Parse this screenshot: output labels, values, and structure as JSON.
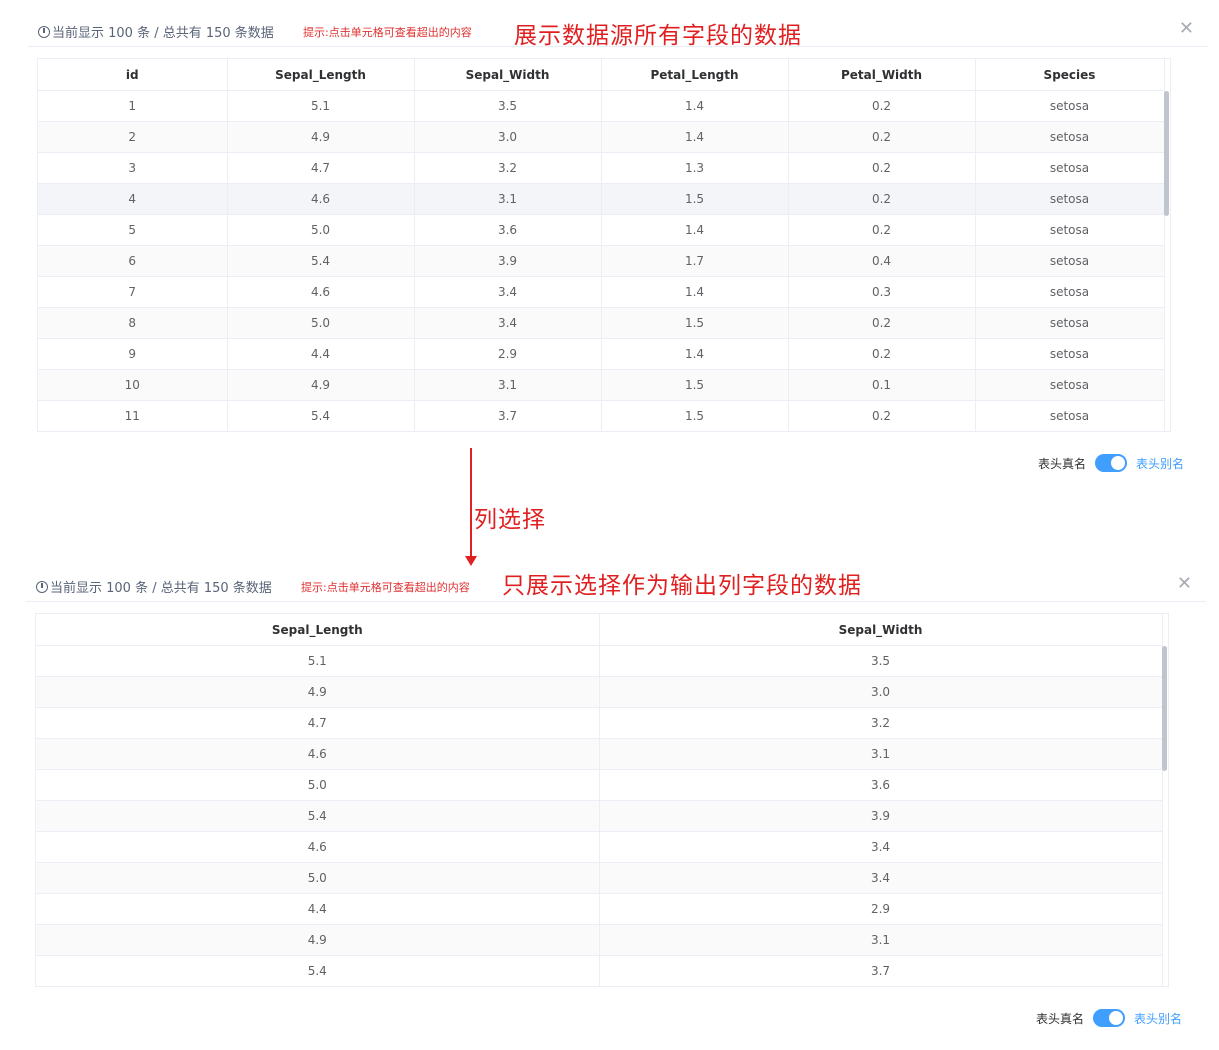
{
  "top": {
    "info": "当前显示 100 条 / 总共有 150 条数据",
    "hint": "提示:点击单元格可查看超出的内容",
    "annotation": "展示数据源所有字段的数据",
    "columns": [
      "id",
      "Sepal_Length",
      "Sepal_Width",
      "Petal_Length",
      "Petal_Width",
      "Species"
    ],
    "rows": [
      [
        "1",
        "5.1",
        "3.5",
        "1.4",
        "0.2",
        "setosa"
      ],
      [
        "2",
        "4.9",
        "3.0",
        "1.4",
        "0.2",
        "setosa"
      ],
      [
        "3",
        "4.7",
        "3.2",
        "1.3",
        "0.2",
        "setosa"
      ],
      [
        "4",
        "4.6",
        "3.1",
        "1.5",
        "0.2",
        "setosa"
      ],
      [
        "5",
        "5.0",
        "3.6",
        "1.4",
        "0.2",
        "setosa"
      ],
      [
        "6",
        "5.4",
        "3.9",
        "1.7",
        "0.4",
        "setosa"
      ],
      [
        "7",
        "4.6",
        "3.4",
        "1.4",
        "0.3",
        "setosa"
      ],
      [
        "8",
        "5.0",
        "3.4",
        "1.5",
        "0.2",
        "setosa"
      ],
      [
        "9",
        "4.4",
        "2.9",
        "1.4",
        "0.2",
        "setosa"
      ],
      [
        "10",
        "4.9",
        "3.1",
        "1.5",
        "0.1",
        "setosa"
      ],
      [
        "11",
        "5.4",
        "3.7",
        "1.5",
        "0.2",
        "setosa"
      ]
    ],
    "switch_left": "表头真名",
    "switch_right": "表头别名"
  },
  "middle_annotation": "列选择",
  "bottom": {
    "info": "当前显示 100 条 / 总共有 150 条数据",
    "hint": "提示:点击单元格可查看超出的内容",
    "annotation": "只展示选择作为输出列字段的数据",
    "columns": [
      "Sepal_Length",
      "Sepal_Width"
    ],
    "rows": [
      [
        "5.1",
        "3.5"
      ],
      [
        "4.9",
        "3.0"
      ],
      [
        "4.7",
        "3.2"
      ],
      [
        "4.6",
        "3.1"
      ],
      [
        "5.0",
        "3.6"
      ],
      [
        "5.4",
        "3.9"
      ],
      [
        "4.6",
        "3.4"
      ],
      [
        "5.0",
        "3.4"
      ],
      [
        "4.4",
        "2.9"
      ],
      [
        "4.9",
        "3.1"
      ],
      [
        "5.4",
        "3.7"
      ]
    ],
    "switch_left": "表头真名",
    "switch_right": "表头别名"
  },
  "colors": {
    "accent": "#409eff",
    "annotation": "#e02020",
    "hint": "#e03131"
  },
  "icons": {
    "close": "close-icon",
    "clock": "clock-icon"
  }
}
